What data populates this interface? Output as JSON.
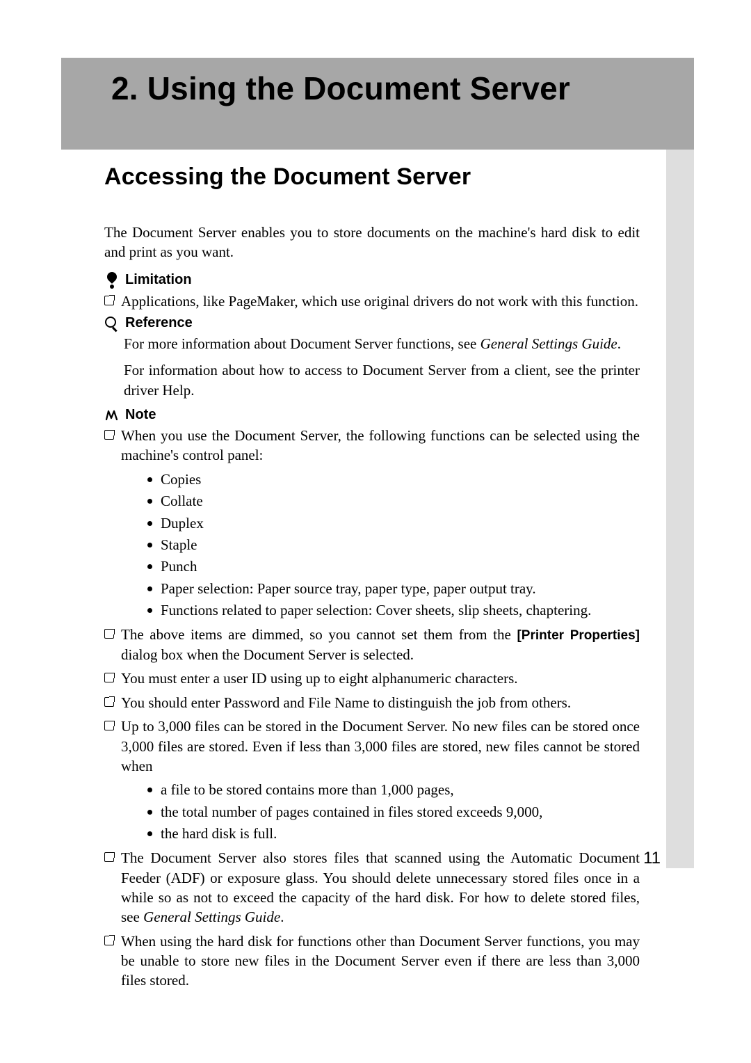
{
  "chapter": {
    "number": "2.",
    "title": "Using the Document Server"
  },
  "section": {
    "title": "Accessing the Document Server"
  },
  "intro": "The Document Server enables you to store documents on the machine's hard disk to edit and print as you want.",
  "limitation": {
    "label": "Limitation",
    "items": [
      "Applications, like PageMaker, which use original drivers do not work with this function."
    ]
  },
  "reference": {
    "label": "Reference",
    "lines": [
      {
        "pre": "For more information about Document Server functions, see  ",
        "em": "General Settings Guide",
        "post": "."
      },
      {
        "pre": "For information about how to access to Document Server from a client, see the printer driver Help.",
        "em": "",
        "post": ""
      }
    ]
  },
  "note": {
    "label": "Note",
    "items": [
      {
        "text": "When you use the Document Server, the following functions can be selected using the machine's control panel:",
        "bullets": [
          "Copies",
          "Collate",
          "Duplex",
          "Staple",
          "Punch",
          "Paper selection: Paper source tray, paper type, paper output tray.",
          "Functions related to paper selection: Cover sheets, slip sheets, chaptering."
        ]
      },
      {
        "rich": {
          "pre": "The above items are dimmed, so you cannot set them from the ",
          "bold": "[Printer Properties]",
          "post": " dialog box when the Document Server is selected."
        }
      },
      {
        "text": "You must enter a user ID using up to eight alphanumeric characters."
      },
      {
        "text": "You should enter Password and File Name to distinguish the job from others."
      },
      {
        "text": "Up to 3,000 files can be stored in the Document Server. No new files can be stored once 3,000 files are stored. Even if less than 3,000 files are stored, new files cannot be stored when",
        "bullets": [
          "a file to be stored contains more than 1,000 pages,",
          "the total number of pages contained in files stored exceeds 9,000,",
          "the hard disk is full."
        ]
      },
      {
        "rich": {
          "pre": "The Document Server also stores files that scanned using the Automatic Document Feeder (ADF) or exposure glass. You should delete unnecessary stored files once in a while so as not to exceed the capacity of the hard disk. For how to delete stored files, see ",
          "em": "General Settings Guide",
          "post": "."
        }
      },
      {
        "text": "When using the hard disk for functions other than Document Server functions, you may be unable to store new files in the Document Server even if there are less than 3,000 files stored."
      }
    ]
  },
  "page_number": "11"
}
